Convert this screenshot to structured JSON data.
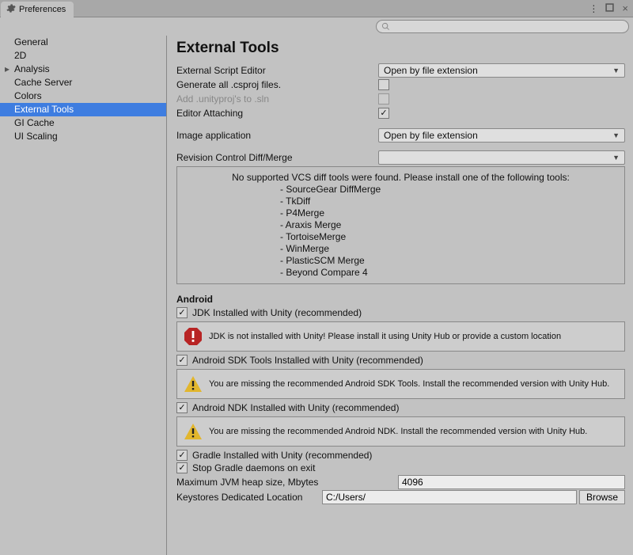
{
  "window": {
    "title": "Preferences",
    "search_placeholder": ""
  },
  "sidebar": {
    "items": [
      {
        "label": "General"
      },
      {
        "label": "2D"
      },
      {
        "label": "Analysis",
        "expandable": true
      },
      {
        "label": "Cache Server"
      },
      {
        "label": "Colors"
      },
      {
        "label": "External Tools",
        "selected": true
      },
      {
        "label": "GI Cache"
      },
      {
        "label": "UI Scaling"
      }
    ]
  },
  "header": {
    "title": "External Tools"
  },
  "fields": {
    "script_editor_label": "External Script Editor",
    "script_editor_value": "Open by file extension",
    "generate_csproj_label": "Generate all .csproj files.",
    "add_unityproj_label": "Add .unityproj's to .sln",
    "editor_attaching_label": "Editor Attaching",
    "image_app_label": "Image application",
    "image_app_value": "Open by file extension",
    "diff_merge_label": "Revision Control Diff/Merge",
    "diff_merge_value": ""
  },
  "diff_info": {
    "header": "No supported VCS diff tools were found. Please install one of the following tools:",
    "tools": [
      "- SourceGear DiffMerge",
      "- TkDiff",
      "- P4Merge",
      "- Araxis Merge",
      "- TortoiseMerge",
      "- WinMerge",
      "- PlasticSCM Merge",
      "- Beyond Compare 4"
    ]
  },
  "android": {
    "title": "Android",
    "jdk_label": "JDK Installed with Unity (recommended)",
    "jdk_alert": "JDK is not installed with Unity! Please install it using Unity Hub or provide a custom location",
    "sdk_label": "Android SDK Tools Installed with Unity (recommended)",
    "sdk_alert": "You are missing the recommended Android SDK Tools. Install the recommended version with Unity Hub.",
    "ndk_label": "Android NDK Installed with Unity (recommended)",
    "ndk_alert": "You are missing the recommended Android NDK. Install the recommended version with Unity Hub.",
    "gradle_label": "Gradle Installed with Unity (recommended)",
    "stop_gradle_label": "Stop Gradle daemons on exit",
    "heap_label": "Maximum JVM heap size, Mbytes",
    "heap_value": "4096",
    "keystore_label": "Keystores Dedicated Location",
    "keystore_value": "C:/Users/",
    "browse": "Browse"
  }
}
